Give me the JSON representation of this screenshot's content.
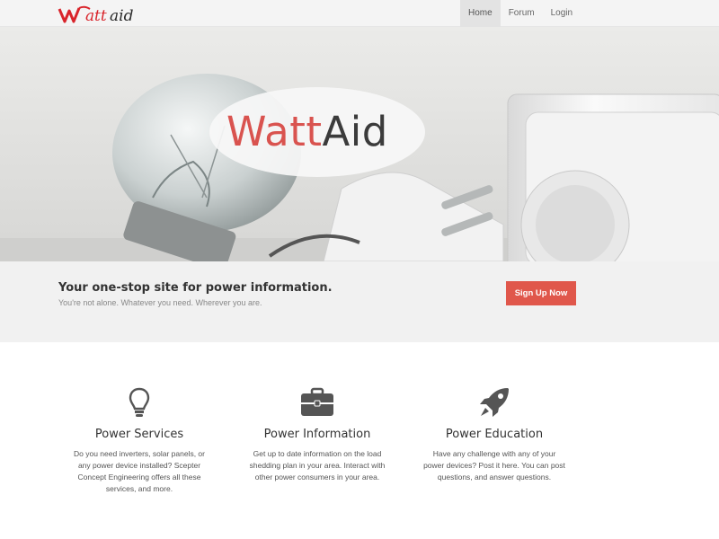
{
  "header": {
    "logo_text": "Wattaid",
    "nav": [
      {
        "label": "Home"
      },
      {
        "label": "Forum"
      },
      {
        "label": "Login"
      }
    ]
  },
  "hero": {
    "title_part1": "Watt",
    "title_part2": "Aid"
  },
  "callout": {
    "headline": "Your one-stop site for power information.",
    "subtext": "You're not alone. Whatever you need. Wherever you are.",
    "button_label": "Sign Up Now"
  },
  "features": [
    {
      "icon": "lightbulb-icon",
      "title": "Power Services",
      "text": "Do you need inverters, solar panels, or any power device installed? Scepter Concept Engineering offers all these services, and more."
    },
    {
      "icon": "briefcase-icon",
      "title": "Power Information",
      "text": "Get up to date information on the load shedding plan in your area. Interact with other power consumers in your area."
    },
    {
      "icon": "rocket-icon",
      "title": "Power Education",
      "text": "Have any challenge with any of your power devices? Post it here. You can post questions, and answer questions."
    }
  ],
  "colors": {
    "accent": "#e0574b",
    "logo_red": "#d9242b",
    "dark_text": "#333333"
  }
}
